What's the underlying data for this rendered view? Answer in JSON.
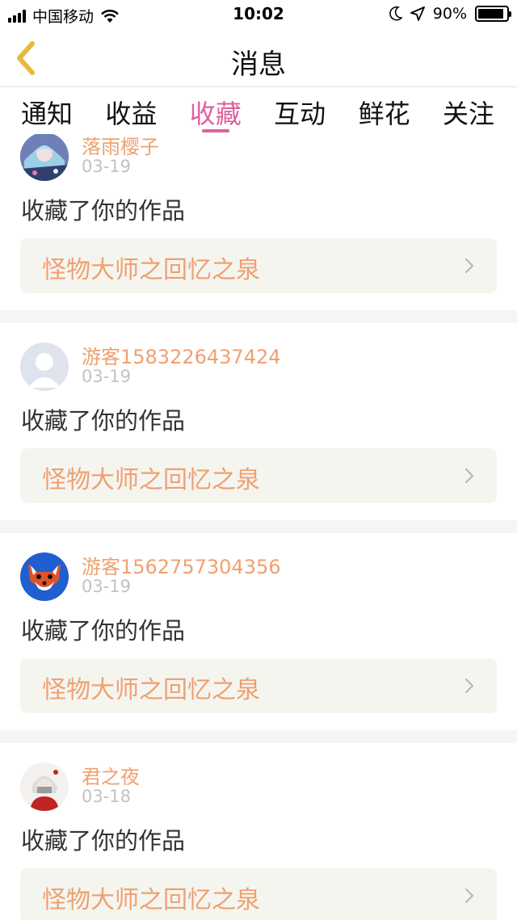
{
  "status_bar": {
    "carrier": "中国移动",
    "time": "10:02",
    "battery": "90%",
    "battery_level": 0.9,
    "icons": [
      "signal-icon",
      "wifi-icon",
      "moon-icon",
      "location-arrow-icon",
      "battery-icon"
    ]
  },
  "nav": {
    "title": "消息",
    "back_icon": "chevron-left-icon",
    "back_color": "#e8b93a"
  },
  "tabs": [
    {
      "label": "通知",
      "active": false
    },
    {
      "label": "收益",
      "active": false
    },
    {
      "label": "收藏",
      "active": true
    },
    {
      "label": "互动",
      "active": false
    },
    {
      "label": "鲜花",
      "active": false
    },
    {
      "label": "关注",
      "active": false
    }
  ],
  "colors": {
    "accent": "#e0609e",
    "username": "#f0a070",
    "date": "#c2c2c2",
    "work_box_bg": "#f5f5f0"
  },
  "notifications": [
    {
      "username": "落雨樱子",
      "date": "03-19",
      "action": "收藏了你的作品",
      "work_title": "怪物大师之回忆之泉",
      "avatar": "anime-girl-avatar"
    },
    {
      "username": "游客1583226437424",
      "date": "03-19",
      "action": "收藏了你的作品",
      "work_title": "怪物大师之回忆之泉",
      "avatar": "default-user-avatar"
    },
    {
      "username": "游客1562757304356",
      "date": "03-19",
      "action": "收藏了你的作品",
      "work_title": "怪物大师之回忆之泉",
      "avatar": "fox-avatar"
    },
    {
      "username": "君之夜",
      "date": "03-18",
      "action": "收藏了你的作品",
      "work_title": "怪物大师之回忆之泉",
      "avatar": "masked-character-avatar"
    }
  ]
}
